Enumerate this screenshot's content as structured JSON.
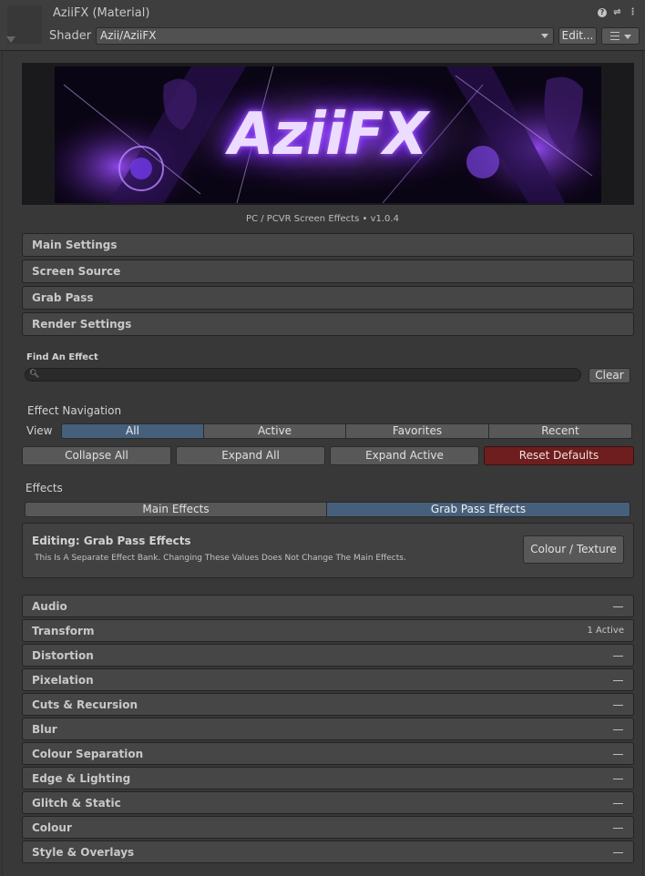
{
  "header": {
    "title": "AziiFX (Material)",
    "shader_label": "Shader",
    "shader_value": "Azii/AziiFX",
    "edit_label": "Edit...",
    "icons": [
      "help-icon",
      "preset-icon",
      "more-icon"
    ]
  },
  "banner": {
    "logo_text": "AziiFX"
  },
  "version_line": "PC / PCVR Screen Effects  •  v1.0.4",
  "sections": [
    {
      "label": "Main Settings"
    },
    {
      "label": "Screen Source"
    },
    {
      "label": "Grab Pass"
    },
    {
      "label": "Render Settings"
    }
  ],
  "search": {
    "label": "Find An Effect",
    "value": "",
    "clear_label": "Clear"
  },
  "navigation": {
    "title": "Effect Navigation",
    "view_label": "View",
    "view_options": [
      {
        "label": "All",
        "selected": true
      },
      {
        "label": "Active",
        "selected": false
      },
      {
        "label": "Favorites",
        "selected": false
      },
      {
        "label": "Recent",
        "selected": false
      }
    ],
    "actions": [
      {
        "label": "Collapse All"
      },
      {
        "label": "Expand All"
      },
      {
        "label": "Expand Active"
      },
      {
        "label": "Reset Defaults"
      }
    ]
  },
  "effects_panel": {
    "title": "Effects",
    "tabs": [
      {
        "label": "Main Effects",
        "selected": false
      },
      {
        "label": "Grab Pass Effects",
        "selected": true
      }
    ],
    "info_title": "Editing: Grab Pass Effects",
    "info_desc": "This Is A Separate Effect Bank. Changing These Values Does Not Change The Main Effects.",
    "colour_texture_label": "Colour / Texture"
  },
  "effects": [
    {
      "label": "Audio",
      "status": ""
    },
    {
      "label": "Transform",
      "status": "1 Active"
    },
    {
      "label": "Distortion",
      "status": ""
    },
    {
      "label": "Pixelation",
      "status": ""
    },
    {
      "label": "Cuts & Recursion",
      "status": ""
    },
    {
      "label": "Blur",
      "status": ""
    },
    {
      "label": "Colour Separation",
      "status": ""
    },
    {
      "label": "Edge & Lighting",
      "status": ""
    },
    {
      "label": "Glitch & Static",
      "status": ""
    },
    {
      "label": "Colour",
      "status": ""
    },
    {
      "label": "Style & Overlays",
      "status": ""
    }
  ],
  "colors": {
    "selected_tab": "#46607c",
    "danger_button": "#6e1e1e",
    "banner_glow": "#7b2cff"
  }
}
